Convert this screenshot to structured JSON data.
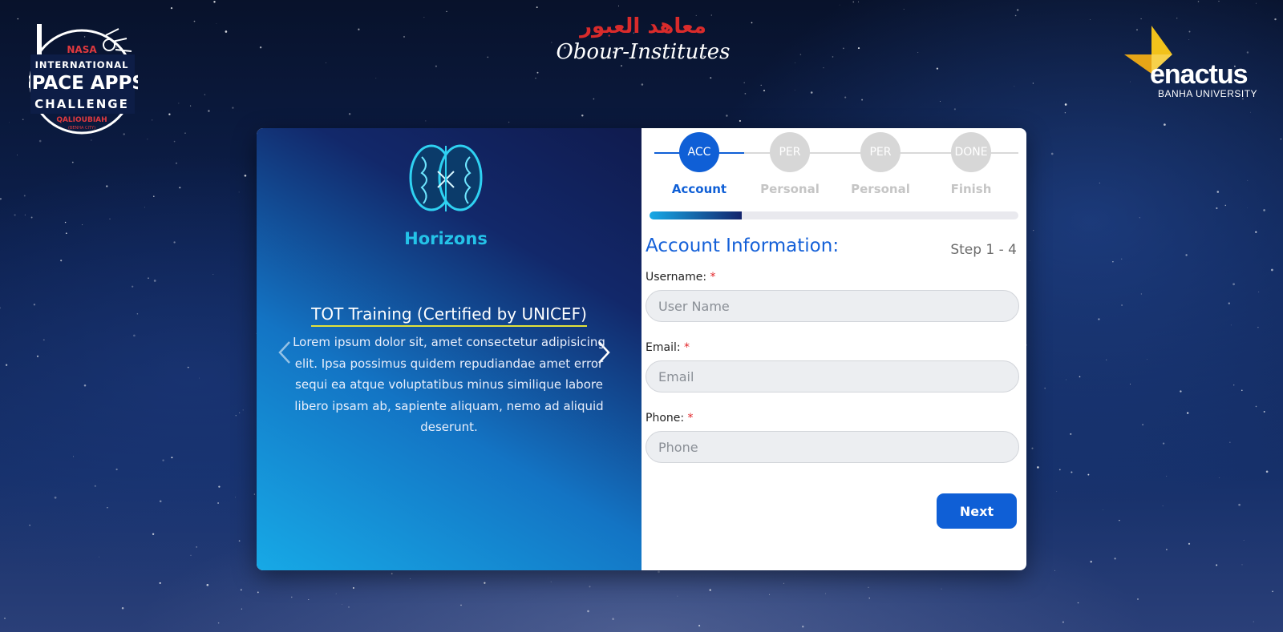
{
  "logos": {
    "nasa": {
      "top": "NASA",
      "line1": "INTERNATIONAL",
      "line2": "SPACE APPS",
      "line3": "CHALLENGE",
      "location": "QALIOUBIAH",
      "city": "(BENHA CITY)"
    },
    "obour": {
      "arabic": "معاهد العبور",
      "english": "Obour-Institutes"
    },
    "enactus": {
      "name": "enactus",
      "sub": "BANHA UNIVERSITY"
    }
  },
  "slider": {
    "brand": "Horizons",
    "title": "TOT Training (Certified by UNICEF)",
    "text": "Lorem ipsum dolor sit, amet consectetur adipisicing elit. Ipsa possimus quidem repudiandae amet error sequi ea atque voluptatibus minus similique labore libero ipsam ab, sapiente aliquam, nemo ad aliquid deserunt."
  },
  "steps": [
    {
      "code": "ACC",
      "label": "Account",
      "active": true
    },
    {
      "code": "PER",
      "label": "Personal",
      "active": false
    },
    {
      "code": "PER",
      "label": "Personal",
      "active": false
    },
    {
      "code": "DONE",
      "label": "Finish",
      "active": false
    }
  ],
  "progress": 0.25,
  "form": {
    "title": "Account Information:",
    "step_count": "Step 1 - 4",
    "required_mark": "*",
    "fields": [
      {
        "label": "Username:",
        "placeholder": "User Name",
        "value": ""
      },
      {
        "label": "Email:",
        "placeholder": "Email",
        "value": ""
      },
      {
        "label": "Phone:",
        "placeholder": "Phone",
        "value": ""
      }
    ],
    "next_label": "Next"
  },
  "colors": {
    "accent": "#0f5fd6",
    "required": "#e2262a",
    "brand_cyan": "#24c3e8",
    "nasa_red": "#e0393e",
    "enactus_yellow": "#f2c21b"
  }
}
